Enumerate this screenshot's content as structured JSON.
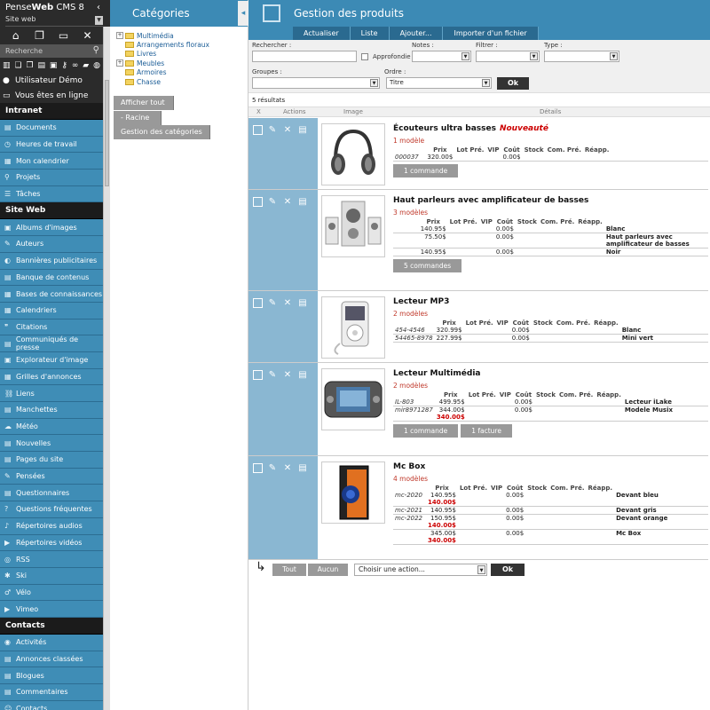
{
  "brand": {
    "pre": "Pense",
    "bold": "Web",
    "post": " CMS 8",
    "collapse_icon": "‹"
  },
  "site_select": "Site web",
  "search_placeholder": "Recherche",
  "user": {
    "name": "Utilisateur Démo",
    "status": "Vous êtes en ligne"
  },
  "sections": {
    "intranet": {
      "title": "Intranet",
      "items": [
        "Documents",
        "Heures de travail",
        "Mon calendrier",
        "Projets",
        "Tâches"
      ]
    },
    "siteweb": {
      "title": "Site Web",
      "items": [
        "Albums d'images",
        "Auteurs",
        "Bannières publicitaires",
        "Banque de contenus",
        "Bases de connaissances",
        "Calendriers",
        "Citations",
        "Communiqués de presse",
        "Explorateur d'image",
        "Grilles d'annonces",
        "Liens",
        "Manchettes",
        "Météo",
        "Nouvelles",
        "Pages du site",
        "Pensées",
        "Questionnaires",
        "Questions fréquentes",
        "Répertoires audios",
        "Répertoires vidéos",
        "RSS",
        "Ski",
        "Vélo",
        "Vimeo"
      ]
    },
    "contacts": {
      "title": "Contacts",
      "items": [
        "Activités",
        "Annonces classées",
        "Blogues",
        "Commentaires",
        "Contacts"
      ]
    }
  },
  "categories": {
    "title": "Catégories",
    "tree": [
      {
        "label": "Multimédia",
        "expandable": true
      },
      {
        "label": "Arrangements floraux",
        "expandable": false
      },
      {
        "label": "Livres",
        "expandable": false
      },
      {
        "label": "Meubles",
        "expandable": true
      },
      {
        "label": "Armoires",
        "expandable": false
      },
      {
        "label": "Chasse",
        "expandable": false
      }
    ],
    "buttons": [
      "Afficher tout",
      "- Racine",
      "Gestion des catégories"
    ]
  },
  "main": {
    "title": "Gestion des produits",
    "tabs": [
      "Actualiser",
      "Liste",
      "Ajouter...",
      "Importer d'un fichier"
    ],
    "filters": {
      "rechercher": "Rechercher :",
      "approfondie": "Approfondie",
      "notes": "Notes :",
      "filtrer": "Filtrer :",
      "type": "Type :",
      "groupes": "Groupes :",
      "ordre": "Ordre :",
      "ordre_value": "Titre",
      "ok": "Ok"
    },
    "results": "5 résultats",
    "columns": [
      "X",
      "Actions",
      "Image",
      "Détails"
    ],
    "price_headers": [
      "Prix",
      "Lot Pré.",
      "VIP",
      "Coût",
      "Stock",
      "Com. Pré.",
      "Réapp."
    ],
    "products": [
      {
        "name": "Écouteurs ultra basses",
        "badge": "Nouveauté",
        "models": "1 modèle",
        "rows": [
          {
            "ref": "000037",
            "prix": "320.00$",
            "promo": "",
            "cout": "0.00$",
            "variant": ""
          }
        ],
        "buttons": [
          "1 commande"
        ]
      },
      {
        "name": "Haut parleurs avec amplificateur de basses",
        "badge": "",
        "models": "3 modèles",
        "rows": [
          {
            "ref": "",
            "prix": "140.95$",
            "promo": "",
            "cout": "0.00$",
            "variant": "Blanc"
          },
          {
            "ref": "",
            "prix": "75.50$",
            "promo": "",
            "cout": "0.00$",
            "variant": "Haut parleurs avec amplificateur de basses"
          },
          {
            "ref": "",
            "prix": "140.95$",
            "promo": "",
            "cout": "0.00$",
            "variant": "Noir"
          }
        ],
        "buttons": [
          "5 commandes"
        ]
      },
      {
        "name": "Lecteur MP3",
        "badge": "",
        "models": "2 modèles",
        "rows": [
          {
            "ref": "454-4546",
            "prix": "320.99$",
            "promo": "",
            "cout": "0.00$",
            "variant": "Blanc"
          },
          {
            "ref": "54465-8978",
            "prix": "227.99$",
            "promo": "",
            "cout": "0.00$",
            "variant": "Mini vert"
          }
        ],
        "buttons": []
      },
      {
        "name": "Lecteur Multimédia",
        "badge": "",
        "models": "2 modèles",
        "rows": [
          {
            "ref": "IL-803",
            "prix": "499.95$",
            "promo": "",
            "cout": "0.00$",
            "variant": "Lecteur iLake"
          },
          {
            "ref": "mir8971287",
            "prix": "344.00$",
            "promo": "340.00$",
            "cout": "0.00$",
            "variant": "Modele Musix"
          }
        ],
        "buttons": [
          "1 commande",
          "1 facture"
        ]
      },
      {
        "name": "Mc Box",
        "badge": "",
        "models": "4 modèles",
        "rows": [
          {
            "ref": "mc-2020",
            "prix": "140.95$",
            "promo": "140.00$",
            "cout": "0.00$",
            "variant": "Devant bleu"
          },
          {
            "ref": "mc-2021",
            "prix": "140.95$",
            "promo": "",
            "cout": "0.00$",
            "variant": "Devant gris"
          },
          {
            "ref": "mc-2022",
            "prix": "150.95$",
            "promo": "140.00$",
            "cout": "0.00$",
            "variant": "Devant orange"
          },
          {
            "ref": "",
            "prix": "345.00$",
            "promo": "340.00$",
            "cout": "0.00$",
            "variant": "Mc Box"
          }
        ],
        "buttons": []
      }
    ],
    "bottom": {
      "tout": "Tout",
      "aucun": "Aucun",
      "action_placeholder": "Choisir une action...",
      "ok": "Ok"
    }
  }
}
